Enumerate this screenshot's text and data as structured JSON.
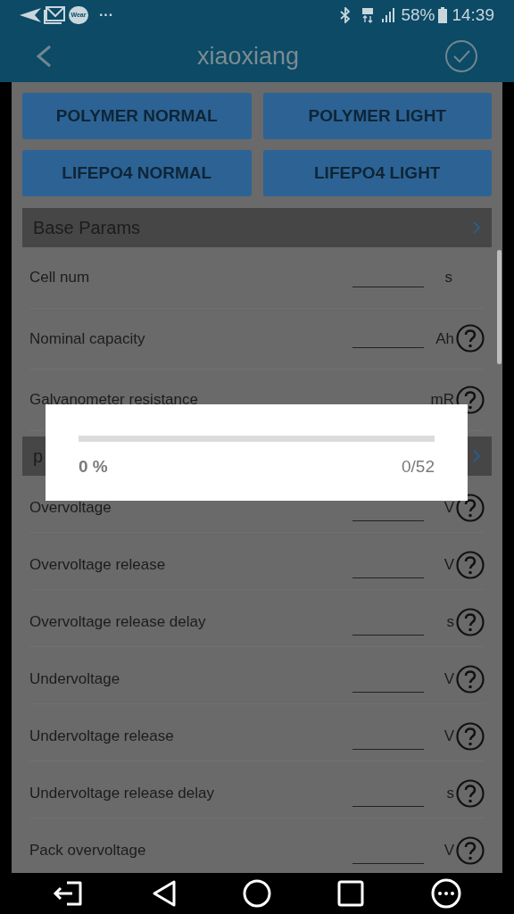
{
  "status_bar": {
    "badge": "Wear",
    "dots": "···",
    "battery": "58%",
    "time": "14:39"
  },
  "header": {
    "title": "xiaoxiang"
  },
  "presets": [
    "POLYMER NORMAL",
    "POLYMER LIGHT",
    "LIFEPO4 NORMAL",
    "LIFEPO4 LIGHT"
  ],
  "sections": [
    {
      "title": "Base Params",
      "rows": [
        {
          "label": "Cell num",
          "unit": "s",
          "help": false
        },
        {
          "label": "Nominal capacity",
          "unit": "Ah",
          "help": true
        },
        {
          "label": "Galvanometer resistance",
          "unit": "mR",
          "help": true
        }
      ]
    },
    {
      "title": "p",
      "rows": [
        {
          "label": "Overvoltage",
          "unit": "V",
          "help": true
        },
        {
          "label": "Overvoltage release",
          "unit": "V",
          "help": true
        },
        {
          "label": "Overvoltage release delay",
          "unit": "s",
          "help": true
        },
        {
          "label": "Undervoltage",
          "unit": "V",
          "help": true
        },
        {
          "label": "Undervoltage release",
          "unit": "V",
          "help": true
        },
        {
          "label": "Undervoltage release delay",
          "unit": "s",
          "help": true
        },
        {
          "label": "Pack overvoltage",
          "unit": "V",
          "help": true
        }
      ]
    }
  ],
  "dialog": {
    "level": 0,
    "percent": "0 %",
    "count": "0/52"
  }
}
